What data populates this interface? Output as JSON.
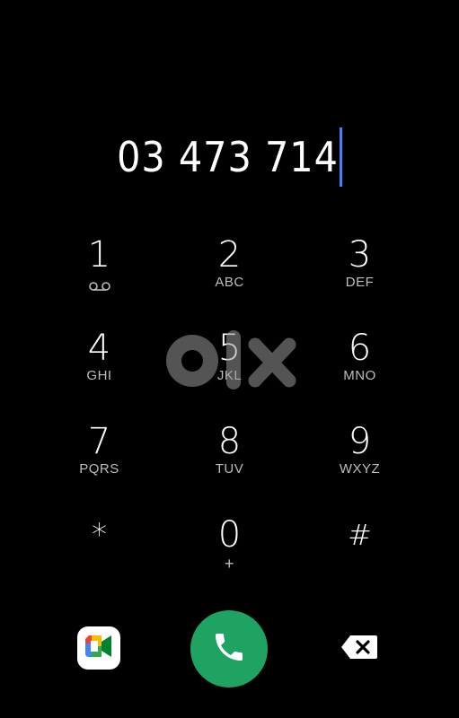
{
  "display": {
    "number": "03 473 714"
  },
  "keypad": {
    "keys": [
      {
        "digit": "1",
        "letters": "",
        "icon": "voicemail-icon"
      },
      {
        "digit": "2",
        "letters": "ABC"
      },
      {
        "digit": "3",
        "letters": "DEF"
      },
      {
        "digit": "4",
        "letters": "GHI"
      },
      {
        "digit": "5",
        "letters": "JKL"
      },
      {
        "digit": "6",
        "letters": "MNO"
      },
      {
        "digit": "7",
        "letters": "PQRS"
      },
      {
        "digit": "8",
        "letters": "TUV"
      },
      {
        "digit": "9",
        "letters": "WXYZ"
      },
      {
        "digit": "*",
        "letters": ""
      },
      {
        "digit": "0",
        "letters": "+"
      },
      {
        "digit": "#",
        "letters": ""
      }
    ]
  },
  "watermark": {
    "brand": "olx"
  },
  "actions": {
    "video_call_icon": "google-meet-icon",
    "call_icon": "phone-icon",
    "delete_icon": "backspace-icon"
  },
  "colors": {
    "background": "#000000",
    "cursor": "#4d7cff",
    "call": "#1ea362"
  }
}
